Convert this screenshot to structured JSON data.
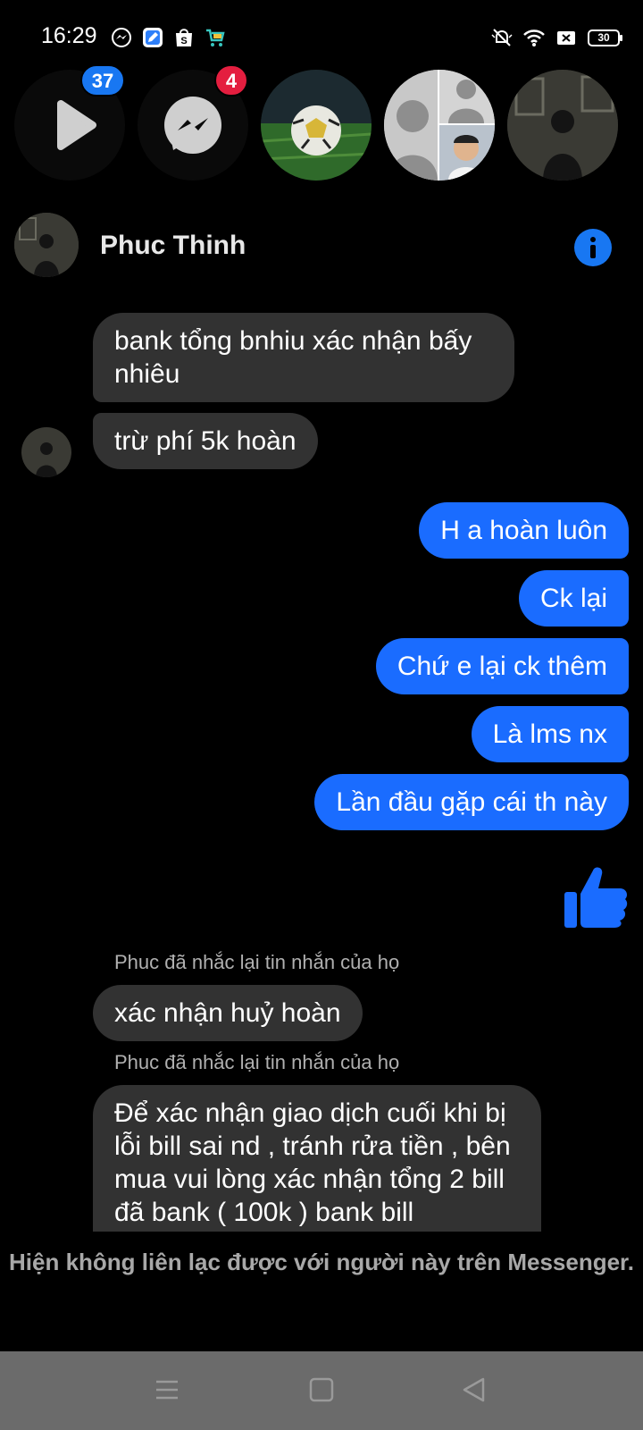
{
  "status_bar": {
    "time": "16:29",
    "battery": "30",
    "left_icons": [
      "messenger-icon",
      "edit-app-icon",
      "shopee-icon",
      "cart-app-icon"
    ],
    "right_icons": [
      "silent-icon",
      "wifi-icon",
      "no-sim-icon",
      "battery-icon"
    ]
  },
  "chat_heads": [
    {
      "name": "video-head",
      "badge": "37",
      "badge_color": "#1877f2"
    },
    {
      "name": "messenger-head",
      "badge": "4",
      "badge_color": "#e41e3f"
    },
    {
      "name": "football-head"
    },
    {
      "name": "group-head"
    },
    {
      "name": "person-head"
    }
  ],
  "chat": {
    "contact_name": "Phuc Thinh",
    "messages": [
      {
        "side": "in",
        "text": "bank tổng bnhiu xác nhận bấy nhiêu"
      },
      {
        "side": "in",
        "text": "trừ phí 5k hoàn"
      },
      {
        "side": "out",
        "text": "H a hoàn luôn"
      },
      {
        "side": "out",
        "text": "Ck lại"
      },
      {
        "side": "out",
        "text": "Chứ e lại ck thêm"
      },
      {
        "side": "out",
        "text": "Là lms nx"
      },
      {
        "side": "out",
        "text": "Lần đầu gặp cái th này"
      },
      {
        "side": "out",
        "type": "like"
      },
      {
        "side": "note",
        "text": "Phuc đã nhắc lại tin nhắn của họ"
      },
      {
        "side": "in",
        "text": "xác nhận huỷ hoàn"
      },
      {
        "side": "note",
        "text": "Phuc đã nhắc lại tin nhắn của họ"
      },
      {
        "side": "in",
        "text": "Để xác nhận giao dịch cuối khi bị lỗi bill sai nd , tránh rửa tiền , bên mua vui lòng xác nhận tổng 2 bill đã bank ( 100k ) bank bill"
      }
    ],
    "footer_notice": "Hiện không liên lạc được với người này trên Messenger."
  },
  "colors": {
    "accent": "#1a6cff",
    "incoming_bubble": "#323232",
    "background": "#000000",
    "nav_bar": "#6b6b6b"
  },
  "nav_bar": {
    "buttons": [
      "menu-icon",
      "home-icon",
      "back-icon"
    ]
  }
}
